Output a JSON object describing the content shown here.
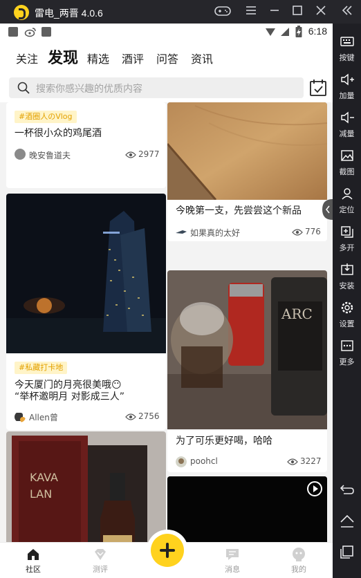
{
  "window": {
    "title": "雷电_两晋 4.0.6"
  },
  "sidebar": {
    "items": [
      {
        "label": "按键",
        "icon": "keyboard-icon"
      },
      {
        "label": "加量",
        "icon": "volume-up-icon"
      },
      {
        "label": "减量",
        "icon": "volume-down-icon"
      },
      {
        "label": "截图",
        "icon": "screenshot-icon"
      },
      {
        "label": "定位",
        "icon": "location-icon"
      },
      {
        "label": "多开",
        "icon": "multi-instance-icon"
      },
      {
        "label": "安装",
        "icon": "install-icon"
      },
      {
        "label": "设置",
        "icon": "settings-gear-icon"
      },
      {
        "label": "更多",
        "icon": "more-icon"
      }
    ]
  },
  "statusbar": {
    "time": "6:18"
  },
  "tabs": [
    {
      "label": "关注"
    },
    {
      "label": "发现",
      "active": true
    },
    {
      "label": "精选"
    },
    {
      "label": "酒评"
    },
    {
      "label": "问答"
    },
    {
      "label": "资讯"
    }
  ],
  "search": {
    "placeholder": "搜索你感兴趣的优质内容"
  },
  "cards": [
    {
      "tag": "#酒圈人のVlog",
      "title": "一杯很小众的鸡尾酒",
      "author": "晚安鲁道夫",
      "views": "2977"
    },
    {
      "title": "今晚第一支，先尝尝这个新品",
      "author": "如果真的太好",
      "views": "776"
    },
    {
      "tag": "#私藏打卡地",
      "title_line1": "今天厦门的月亮很美哦😶",
      "title_line2": "“举杯邀明月 对影成三人”",
      "author": "Allen曾",
      "views": "2756"
    },
    {
      "title": "为了可乐更好喝，哈哈",
      "author": "poohcl",
      "views": "3227"
    }
  ],
  "bottom_nav": [
    {
      "label": "社区",
      "active": true
    },
    {
      "label": "测评"
    },
    {
      "label": "消息"
    },
    {
      "label": "我的"
    }
  ],
  "colors": {
    "accent": "#ffd21e",
    "tag_bg": "#fff4c8",
    "tag_text": "#e3a100"
  }
}
